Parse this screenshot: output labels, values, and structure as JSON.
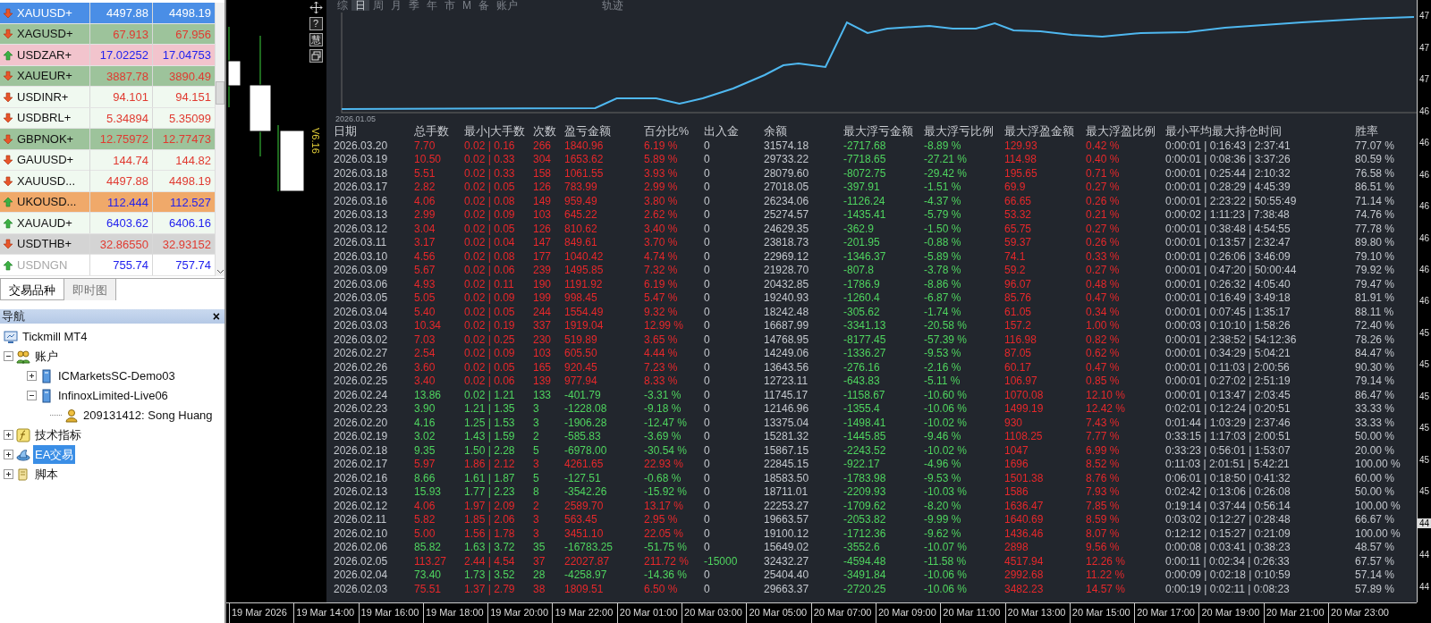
{
  "market_watch": {
    "rows": [
      {
        "symbol": "XAUUSD+",
        "bid": "4497.88",
        "ask": "4498.19",
        "kind": "down",
        "color": "#4a8ee6",
        "selected": true,
        "dimmed": false
      },
      {
        "symbol": "XAGUSD+",
        "bid": "67.913",
        "ask": "67.956",
        "kind": "down",
        "color": "#9dc39b",
        "selected": false,
        "dimmed": false
      },
      {
        "symbol": "USDZAR+",
        "bid": "17.02252",
        "ask": "17.04753",
        "kind": "up",
        "color": "#f2c4cd",
        "selected": false,
        "dimmed": false
      },
      {
        "symbol": "XAUEUR+",
        "bid": "3887.78",
        "ask": "3890.49",
        "kind": "down",
        "color": "#9dc39b",
        "selected": false,
        "dimmed": false
      },
      {
        "symbol": "USDINR+",
        "bid": "94.101",
        "ask": "94.151",
        "kind": "down",
        "color": "#f0f9f0",
        "selected": false,
        "dimmed": false
      },
      {
        "symbol": "USDBRL+",
        "bid": "5.34894",
        "ask": "5.35099",
        "kind": "down",
        "color": "#f0f9f0",
        "selected": false,
        "dimmed": false
      },
      {
        "symbol": "GBPNOK+",
        "bid": "12.75972",
        "ask": "12.77473",
        "kind": "down",
        "color": "#9dc39b",
        "selected": false,
        "dimmed": false
      },
      {
        "symbol": "GAUUSD+",
        "bid": "144.74",
        "ask": "144.82",
        "kind": "down",
        "color": "#f0f9f0",
        "selected": false,
        "dimmed": false
      },
      {
        "symbol": "XAUUSD...",
        "bid": "4497.88",
        "ask": "4498.19",
        "kind": "down",
        "color": "#f0f9f0",
        "selected": false,
        "dimmed": false
      },
      {
        "symbol": "UKOUSD...",
        "bid": "112.444",
        "ask": "112.527",
        "kind": "up",
        "color": "#f0a96a",
        "selected": false,
        "dimmed": false
      },
      {
        "symbol": "XAUAUD+",
        "bid": "6403.62",
        "ask": "6406.16",
        "kind": "up",
        "color": "#f0f9f0",
        "selected": false,
        "dimmed": false
      },
      {
        "symbol": "USDTHB+",
        "bid": "32.86550",
        "ask": "32.93152",
        "kind": "down",
        "color": "#d4d4d4",
        "selected": false,
        "dimmed": false
      },
      {
        "symbol": "USDNGN",
        "bid": "755.74",
        "ask": "757.74",
        "kind": "up",
        "color": "#ffffff",
        "selected": false,
        "dimmed": true
      }
    ],
    "tabs": [
      {
        "label": "交易品种",
        "selected": true
      },
      {
        "label": "即时图",
        "selected": false
      }
    ]
  },
  "navigator": {
    "title": "导航",
    "close": "×",
    "tree": [
      {
        "label": "Tickmill MT4",
        "kind": "terminal",
        "selected": false,
        "children": [
          {
            "label": "账户",
            "kind": "accounts",
            "expanded": true,
            "selected": false,
            "children": [
              {
                "label": "ICMarketsSC-Demo03",
                "kind": "server",
                "expanded": false,
                "selected": false
              },
              {
                "label": "InfinoxLimited-Live06",
                "kind": "server",
                "expanded": true,
                "selected": false,
                "children": [
                  {
                    "label": "209131412: Song Huang",
                    "kind": "user",
                    "selected": false
                  }
                ]
              }
            ]
          },
          {
            "label": "技术指标",
            "kind": "indicator",
            "expanded": false,
            "selected": false
          },
          {
            "label": "EA交易",
            "kind": "expert",
            "expanded": false,
            "selected": true
          },
          {
            "label": "脚本",
            "kind": "script",
            "expanded": false,
            "selected": false
          }
        ]
      }
    ]
  },
  "chart": {
    "version_label": "V6.16",
    "tool_buttons": [
      {
        "kind": "move"
      },
      {
        "kind": "text",
        "label": "?"
      },
      {
        "kind": "text",
        "label": "慧"
      },
      {
        "kind": "restore"
      }
    ],
    "price_axis": [
      {
        "label": "47",
        "current": false
      },
      {
        "label": "47",
        "current": false
      },
      {
        "label": "47",
        "current": false
      },
      {
        "label": "46",
        "current": false
      },
      {
        "label": "46",
        "current": false
      },
      {
        "label": "46",
        "current": false
      },
      {
        "label": "46",
        "current": false
      },
      {
        "label": "46",
        "current": false
      },
      {
        "label": "46",
        "current": false
      },
      {
        "label": "46",
        "current": false
      },
      {
        "label": "45",
        "current": false
      },
      {
        "label": "45",
        "current": false
      },
      {
        "label": "45",
        "current": false
      },
      {
        "label": "45",
        "current": false
      },
      {
        "label": "45",
        "current": false
      },
      {
        "label": "45",
        "current": false
      },
      {
        "label": "44",
        "current": true
      },
      {
        "label": "44",
        "current": false
      },
      {
        "label": "44",
        "current": false
      }
    ],
    "time_axis": [
      "19 Mar 2026",
      "19 Mar 14:00",
      "19 Mar 16:00",
      "19 Mar 18:00",
      "19 Mar 20:00",
      "19 Mar 22:00",
      "20 Mar 01:00",
      "20 Mar 03:00",
      "20 Mar 05:00",
      "20 Mar 07:00",
      "20 Mar 09:00",
      "20 Mar 11:00",
      "20 Mar 13:00",
      "20 Mar 15:00",
      "20 Mar 17:00",
      "20 Mar 19:00",
      "20 Mar 21:00",
      "20 Mar 23:00"
    ]
  },
  "report": {
    "tabs": [
      {
        "label": "综",
        "selected": false
      },
      {
        "label": "日",
        "selected": true
      },
      {
        "label": "周",
        "selected": false
      },
      {
        "label": "月",
        "selected": false
      },
      {
        "label": "季",
        "selected": false
      },
      {
        "label": "年",
        "selected": false
      },
      {
        "label": "市",
        "selected": false
      },
      {
        "label": "M",
        "selected": false
      },
      {
        "label": "备",
        "selected": false
      },
      {
        "label": "账户",
        "selected": false
      },
      {
        "label": "轨迹",
        "selected": false
      }
    ],
    "equity_curve": {
      "start_label": "2026.01.05"
    },
    "table": {
      "columns": [
        {
          "label": "日期",
          "kind": "neutral"
        },
        {
          "label": "总手数",
          "kind": "result"
        },
        {
          "label": "最小|大手数",
          "kind": "result"
        },
        {
          "label": "次数",
          "kind": "result"
        },
        {
          "label": "盈亏金额",
          "kind": "result"
        },
        {
          "label": "百分比%",
          "kind": "result"
        },
        {
          "label": "出入金",
          "kind": "cash"
        },
        {
          "label": "余额",
          "kind": "neutral"
        },
        {
          "label": "最大浮亏金额",
          "kind": "loss"
        },
        {
          "label": "最大浮亏比例",
          "kind": "loss"
        },
        {
          "label": "最大浮盈金额",
          "kind": "gain"
        },
        {
          "label": "最大浮盈比例",
          "kind": "gain"
        },
        {
          "label": "最小平均最大持仓时间",
          "kind": "neutral"
        },
        {
          "label": "胜率",
          "kind": "neutral"
        }
      ],
      "rows": [
        {
          "kind": "gain",
          "withdrawal": false,
          "cells": [
            "2026.03.20",
            "7.70",
            "0.02 | 0.16",
            "266",
            "1840.96",
            "6.19 %",
            "0",
            "31574.18",
            "-2717.68",
            "-8.89 %",
            "129.93",
            "0.42 %",
            "0:00:01 | 0:16:43 | 2:37:41",
            "77.07 %"
          ]
        },
        {
          "kind": "gain",
          "withdrawal": false,
          "cells": [
            "2026.03.19",
            "10.50",
            "0.02 | 0.33",
            "304",
            "1653.62",
            "5.89 %",
            "0",
            "29733.22",
            "-7718.65",
            "-27.21 %",
            "114.98",
            "0.40 %",
            "0:00:01 | 0:08:36 | 3:37:26",
            "80.59 %"
          ]
        },
        {
          "kind": "gain",
          "withdrawal": false,
          "cells": [
            "2026.03.18",
            "5.51",
            "0.02 | 0.33",
            "158",
            "1061.55",
            "3.93 %",
            "0",
            "28079.60",
            "-8072.75",
            "-29.42 %",
            "195.65",
            "0.71 %",
            "0:00:01 | 0:25:44 | 2:10:32",
            "76.58 %"
          ]
        },
        {
          "kind": "gain",
          "withdrawal": false,
          "cells": [
            "2026.03.17",
            "2.82",
            "0.02 | 0.05",
            "126",
            "783.99",
            "2.99 %",
            "0",
            "27018.05",
            "-397.91",
            "-1.51 %",
            "69.9",
            "0.27 %",
            "0:00:01 | 0:28:29 | 4:45:39",
            "86.51 %"
          ]
        },
        {
          "kind": "gain",
          "withdrawal": false,
          "cells": [
            "2026.03.16",
            "4.06",
            "0.02 | 0.08",
            "149",
            "959.49",
            "3.80 %",
            "0",
            "26234.06",
            "-1126.24",
            "-4.37 %",
            "66.65",
            "0.26 %",
            "0:00:01 | 2:23:22 | 50:55:49",
            "71.14 %"
          ]
        },
        {
          "kind": "gain",
          "withdrawal": false,
          "cells": [
            "2026.03.13",
            "2.99",
            "0.02 | 0.09",
            "103",
            "645.22",
            "2.62 %",
            "0",
            "25274.57",
            "-1435.41",
            "-5.79 %",
            "53.32",
            "0.21 %",
            "0:00:02 | 1:11:23 | 7:38:48",
            "74.76 %"
          ]
        },
        {
          "kind": "gain",
          "withdrawal": false,
          "cells": [
            "2026.03.12",
            "3.04",
            "0.02 | 0.05",
            "126",
            "810.62",
            "3.40 %",
            "0",
            "24629.35",
            "-362.9",
            "-1.50 %",
            "65.75",
            "0.27 %",
            "0:00:01 | 0:38:48 | 4:54:55",
            "77.78 %"
          ]
        },
        {
          "kind": "gain",
          "withdrawal": false,
          "cells": [
            "2026.03.11",
            "3.17",
            "0.02 | 0.04",
            "147",
            "849.61",
            "3.70 %",
            "0",
            "23818.73",
            "-201.95",
            "-0.88 %",
            "59.37",
            "0.26 %",
            "0:00:01 | 0:13:57 | 2:32:47",
            "89.80 %"
          ]
        },
        {
          "kind": "gain",
          "withdrawal": false,
          "cells": [
            "2026.03.10",
            "4.56",
            "0.02 | 0.08",
            "177",
            "1040.42",
            "4.74 %",
            "0",
            "22969.12",
            "-1346.37",
            "-5.89 %",
            "74.1",
            "0.33 %",
            "0:00:01 | 0:26:06 | 3:46:09",
            "79.10 %"
          ]
        },
        {
          "kind": "gain",
          "withdrawal": false,
          "cells": [
            "2026.03.09",
            "5.67",
            "0.02 | 0.06",
            "239",
            "1495.85",
            "7.32 %",
            "0",
            "21928.70",
            "-807.8",
            "-3.78 %",
            "59.2",
            "0.27 %",
            "0:00:01 | 0:47:20 | 50:00:44",
            "79.92 %"
          ]
        },
        {
          "kind": "gain",
          "withdrawal": false,
          "cells": [
            "2026.03.06",
            "4.93",
            "0.02 | 0.11",
            "190",
            "1191.92",
            "6.19 %",
            "0",
            "20432.85",
            "-1786.9",
            "-8.86 %",
            "96.07",
            "0.48 %",
            "0:00:01 | 0:26:32 | 4:05:40",
            "79.47 %"
          ]
        },
        {
          "kind": "gain",
          "withdrawal": false,
          "cells": [
            "2026.03.05",
            "5.05",
            "0.02 | 0.09",
            "199",
            "998.45",
            "5.47 %",
            "0",
            "19240.93",
            "-1260.4",
            "-6.87 %",
            "85.76",
            "0.47 %",
            "0:00:01 | 0:16:49 | 3:49:18",
            "81.91 %"
          ]
        },
        {
          "kind": "gain",
          "withdrawal": false,
          "cells": [
            "2026.03.04",
            "5.40",
            "0.02 | 0.05",
            "244",
            "1554.49",
            "9.32 %",
            "0",
            "18242.48",
            "-305.62",
            "-1.74 %",
            "61.05",
            "0.34 %",
            "0:00:01 | 0:07:45 | 1:35:17",
            "88.11 %"
          ]
        },
        {
          "kind": "gain",
          "withdrawal": false,
          "cells": [
            "2026.03.03",
            "10.34",
            "0.02 | 0.19",
            "337",
            "1919.04",
            "12.99 %",
            "0",
            "16687.99",
            "-3341.13",
            "-20.58 %",
            "157.2",
            "1.00 %",
            "0:00:03 | 0:10:10 | 1:58:26",
            "72.40 %"
          ]
        },
        {
          "kind": "gain",
          "withdrawal": false,
          "cells": [
            "2026.03.02",
            "7.03",
            "0.02 | 0.25",
            "230",
            "519.89",
            "3.65 %",
            "0",
            "14768.95",
            "-8177.45",
            "-57.39 %",
            "116.98",
            "0.82 %",
            "0:00:01 | 2:38:52 | 54:12:36",
            "78.26 %"
          ]
        },
        {
          "kind": "gain",
          "withdrawal": false,
          "cells": [
            "2026.02.27",
            "2.54",
            "0.02 | 0.09",
            "103",
            "605.50",
            "4.44 %",
            "0",
            "14249.06",
            "-1336.27",
            "-9.53 %",
            "87.05",
            "0.62 %",
            "0:00:01 | 0:34:29 | 5:04:21",
            "84.47 %"
          ]
        },
        {
          "kind": "gain",
          "withdrawal": false,
          "cells": [
            "2026.02.26",
            "3.60",
            "0.02 | 0.05",
            "165",
            "920.45",
            "7.23 %",
            "0",
            "13643.56",
            "-276.16",
            "-2.16 %",
            "60.17",
            "0.47 %",
            "0:00:01 | 0:11:03 | 2:00:56",
            "90.30 %"
          ]
        },
        {
          "kind": "gain",
          "withdrawal": false,
          "cells": [
            "2026.02.25",
            "3.40",
            "0.02 | 0.06",
            "139",
            "977.94",
            "8.33 %",
            "0",
            "12723.11",
            "-643.83",
            "-5.11 %",
            "106.97",
            "0.85 %",
            "0:00:01 | 0:27:02 | 2:51:19",
            "79.14 %"
          ]
        },
        {
          "kind": "loss",
          "withdrawal": false,
          "cells": [
            "2026.02.24",
            "13.86",
            "0.02 | 1.21",
            "133",
            "-401.79",
            "-3.31 %",
            "0",
            "11745.17",
            "-1158.67",
            "-10.60 %",
            "1070.08",
            "12.10 %",
            "0:00:01 | 0:13:47 | 2:03:45",
            "86.47 %"
          ]
        },
        {
          "kind": "loss",
          "withdrawal": false,
          "cells": [
            "2026.02.23",
            "3.90",
            "1.21 | 1.35",
            "3",
            "-1228.08",
            "-9.18 %",
            "0",
            "12146.96",
            "-1355.4",
            "-10.06 %",
            "1499.19",
            "12.42 %",
            "0:02:01 | 0:12:24 | 0:20:51",
            "33.33 %"
          ]
        },
        {
          "kind": "loss",
          "withdrawal": false,
          "cells": [
            "2026.02.20",
            "4.16",
            "1.25 | 1.53",
            "3",
            "-1906.28",
            "-12.47 %",
            "0",
            "13375.04",
            "-1498.41",
            "-10.02 %",
            "930",
            "7.43 %",
            "0:01:44 | 1:03:29 | 2:37:46",
            "33.33 %"
          ]
        },
        {
          "kind": "loss",
          "withdrawal": false,
          "cells": [
            "2026.02.19",
            "3.02",
            "1.43 | 1.59",
            "2",
            "-585.83",
            "-3.69 %",
            "0",
            "15281.32",
            "-1445.85",
            "-9.46 %",
            "1108.25",
            "7.77 %",
            "0:33:15 | 1:17:03 | 2:00:51",
            "50.00 %"
          ]
        },
        {
          "kind": "loss",
          "withdrawal": false,
          "cells": [
            "2026.02.18",
            "9.35",
            "1.50 | 2.28",
            "5",
            "-6978.00",
            "-30.54 %",
            "0",
            "15867.15",
            "-2243.52",
            "-10.02 %",
            "1047",
            "6.99 %",
            "0:33:23 | 0:56:01 | 1:53:07",
            "20.00 %"
          ]
        },
        {
          "kind": "gain",
          "withdrawal": false,
          "cells": [
            "2026.02.17",
            "5.97",
            "1.86 | 2.12",
            "3",
            "4261.65",
            "22.93 %",
            "0",
            "22845.15",
            "-922.17",
            "-4.96 %",
            "1696",
            "8.52 %",
            "0:11:03 | 2:01:51 | 5:42:21",
            "100.00 %"
          ]
        },
        {
          "kind": "loss",
          "withdrawal": false,
          "cells": [
            "2026.02.16",
            "8.66",
            "1.61 | 1.87",
            "5",
            "-127.51",
            "-0.68 %",
            "0",
            "18583.50",
            "-1783.98",
            "-9.53 %",
            "1501.38",
            "8.76 %",
            "0:06:01 | 0:18:50 | 0:41:32",
            "60.00 %"
          ]
        },
        {
          "kind": "loss",
          "withdrawal": false,
          "cells": [
            "2026.02.13",
            "15.93",
            "1.77 | 2.23",
            "8",
            "-3542.26",
            "-15.92 %",
            "0",
            "18711.01",
            "-2209.93",
            "-10.03 %",
            "1586",
            "7.93 %",
            "0:02:42 | 0:13:06 | 0:26:08",
            "50.00 %"
          ]
        },
        {
          "kind": "gain",
          "withdrawal": false,
          "cells": [
            "2026.02.12",
            "4.06",
            "1.97 | 2.09",
            "2",
            "2589.70",
            "13.17 %",
            "0",
            "22253.27",
            "-1709.62",
            "-8.20 %",
            "1636.47",
            "7.85 %",
            "0:19:14 | 0:37:44 | 0:56:14",
            "100.00 %"
          ]
        },
        {
          "kind": "gain",
          "withdrawal": false,
          "cells": [
            "2026.02.11",
            "5.82",
            "1.85 | 2.06",
            "3",
            "563.45",
            "2.95 %",
            "0",
            "19663.57",
            "-2053.82",
            "-9.99 %",
            "1640.69",
            "8.59 %",
            "0:03:02 | 0:12:27 | 0:28:48",
            "66.67 %"
          ]
        },
        {
          "kind": "gain",
          "withdrawal": false,
          "cells": [
            "2026.02.10",
            "5.00",
            "1.56 | 1.78",
            "3",
            "3451.10",
            "22.05 %",
            "0",
            "19100.12",
            "-1712.36",
            "-9.62 %",
            "1436.46",
            "8.07 %",
            "0:12:12 | 0:15:27 | 0:21:09",
            "100.00 %"
          ]
        },
        {
          "kind": "loss",
          "withdrawal": false,
          "cells": [
            "2026.02.06",
            "85.82",
            "1.63 | 3.72",
            "35",
            "-16783.25",
            "-51.75 %",
            "0",
            "15649.02",
            "-3552.6",
            "-10.07 %",
            "2898",
            "9.56 %",
            "0:00:08 | 0:03:41 | 0:38:23",
            "48.57 %"
          ]
        },
        {
          "kind": "gain",
          "withdrawal": true,
          "cells": [
            "2026.02.05",
            "113.27",
            "2.44 | 4.54",
            "37",
            "22027.87",
            "211.72 %",
            "-15000",
            "32432.27",
            "-4594.48",
            "-11.58 %",
            "4517.94",
            "12.26 %",
            "0:00:11 | 0:02:34 | 0:26:33",
            "67.57 %"
          ]
        },
        {
          "kind": "loss",
          "withdrawal": false,
          "cells": [
            "2026.02.04",
            "73.40",
            "1.73 | 3.52",
            "28",
            "-4258.97",
            "-14.36 %",
            "0",
            "25404.40",
            "-3491.84",
            "-10.06 %",
            "2992.68",
            "11.22 %",
            "0:00:09 | 0:02:18 | 0:10:59",
            "57.14 %"
          ]
        },
        {
          "kind": "gain",
          "withdrawal": false,
          "cells": [
            "2026.02.03",
            "75.51",
            "1.37 | 2.79",
            "38",
            "1809.51",
            "6.50 %",
            "0",
            "29663.37",
            "-2720.25",
            "-10.06 %",
            "3482.23",
            "14.57 %",
            "0:00:19 | 0:02:11 | 0:08:23",
            "57.89 %"
          ]
        }
      ]
    }
  }
}
